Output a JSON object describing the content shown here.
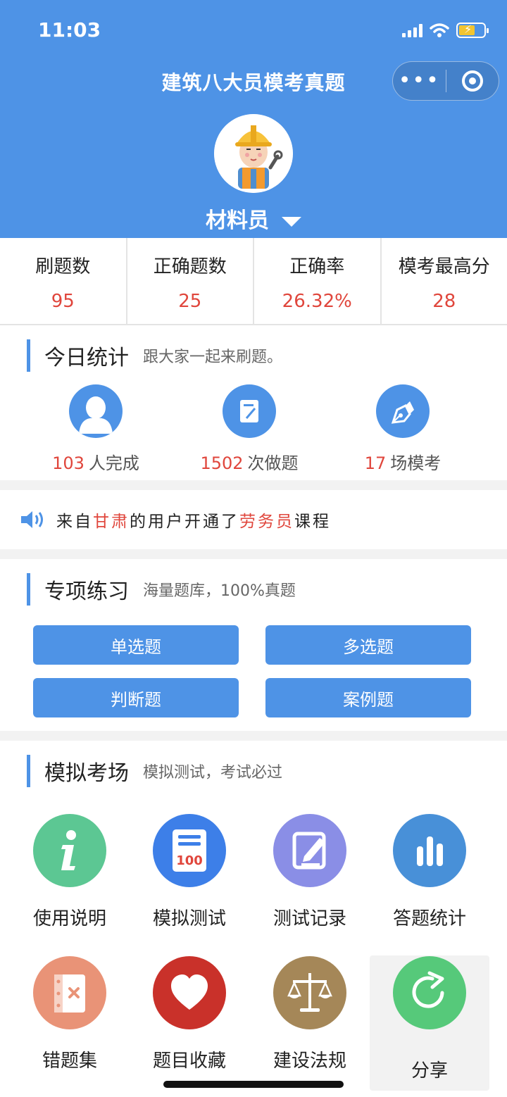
{
  "status_bar": {
    "time": "11:03"
  },
  "header": {
    "title": "建筑八大员模考真题",
    "role": "材料员"
  },
  "stats": [
    {
      "label": "刷题数",
      "value": "95"
    },
    {
      "label": "正确题数",
      "value": "25"
    },
    {
      "label": "正确率",
      "value": "26.32%"
    },
    {
      "label": "模考最高分",
      "value": "28"
    }
  ],
  "today": {
    "title": "今日统计",
    "subtitle": "跟大家一起来刷题。",
    "items": [
      {
        "num": "103",
        "unit": "人完成",
        "icon": "user-icon"
      },
      {
        "num": "1502",
        "unit": "次做题",
        "icon": "edit-icon"
      },
      {
        "num": "17",
        "unit": "场模考",
        "icon": "pen-icon"
      }
    ]
  },
  "notice": {
    "prefix": "来自",
    "region": "甘肃",
    "middle": "的用户开通了",
    "course": "劳务员",
    "suffix": "课程"
  },
  "practice": {
    "title": "专项练习",
    "subtitle": "海量题库，100%真题",
    "buttons": [
      "单选题",
      "多选题",
      "判断题",
      "案例题"
    ]
  },
  "mock": {
    "title": "模拟考场",
    "subtitle": "模拟测试，考试必过",
    "tools": [
      {
        "label": "使用说明",
        "icon": "info-icon",
        "color": "#5cc793"
      },
      {
        "label": "模拟测试",
        "icon": "score-100-icon",
        "color": "#3d7fe8"
      },
      {
        "label": "测试记录",
        "icon": "note-edit-icon",
        "color": "#8a8ee6"
      },
      {
        "label": "答题统计",
        "icon": "bar-chart-icon",
        "color": "#4890d8"
      },
      {
        "label": "错题集",
        "icon": "wrong-notebook-icon",
        "color": "#e99377"
      },
      {
        "label": "题目收藏",
        "icon": "heart-icon",
        "color": "#c9312a"
      },
      {
        "label": "建设法规",
        "icon": "scales-icon",
        "color": "#a58758"
      },
      {
        "label": "分享",
        "icon": "share-icon",
        "color": "#56c97a"
      }
    ]
  }
}
